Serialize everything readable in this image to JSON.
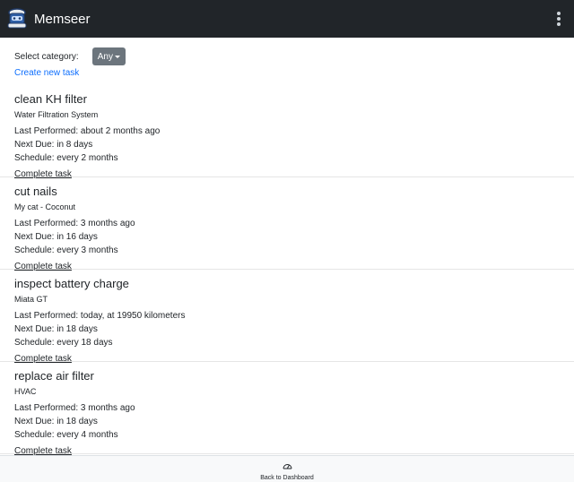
{
  "navbar": {
    "brand": "Memseer",
    "logo_icon": "robot-mascot-icon",
    "menu_icon": "kebab-menu-icon"
  },
  "controls": {
    "category_label": "Select category:",
    "category_value": "Any",
    "create_link": "Create new task"
  },
  "tasks": [
    {
      "title": "clean KH filter",
      "subtitle": "Water Filtration System",
      "last_performed": "Last Performed: about 2 months ago",
      "next_due": "Next Due: in 8 days",
      "schedule": "Schedule: every 2 months",
      "action": "Complete task"
    },
    {
      "title": "cut nails",
      "subtitle": "My cat - Coconut",
      "last_performed": "Last Performed: 3 months ago",
      "next_due": "Next Due: in 16 days",
      "schedule": "Schedule: every 3 months",
      "action": "Complete task"
    },
    {
      "title": "inspect battery charge",
      "subtitle": "Miata GT",
      "last_performed": "Last Performed: today, at 19950 kilometers",
      "next_due": "Next Due: in 18 days",
      "schedule": "Schedule: every 18 days",
      "action": "Complete task"
    },
    {
      "title": "replace air filter",
      "subtitle": "HVAC",
      "last_performed": "Last Performed: 3 months ago",
      "next_due": "Next Due: in 18 days",
      "schedule": "Schedule: every 4 months",
      "action": "Complete task"
    }
  ],
  "footer": {
    "label": "Back to Dashboard",
    "icon": "speedometer-icon"
  },
  "colors": {
    "navbar_bg": "#212529",
    "link": "#0d6efd",
    "button_secondary": "#6c757d"
  }
}
